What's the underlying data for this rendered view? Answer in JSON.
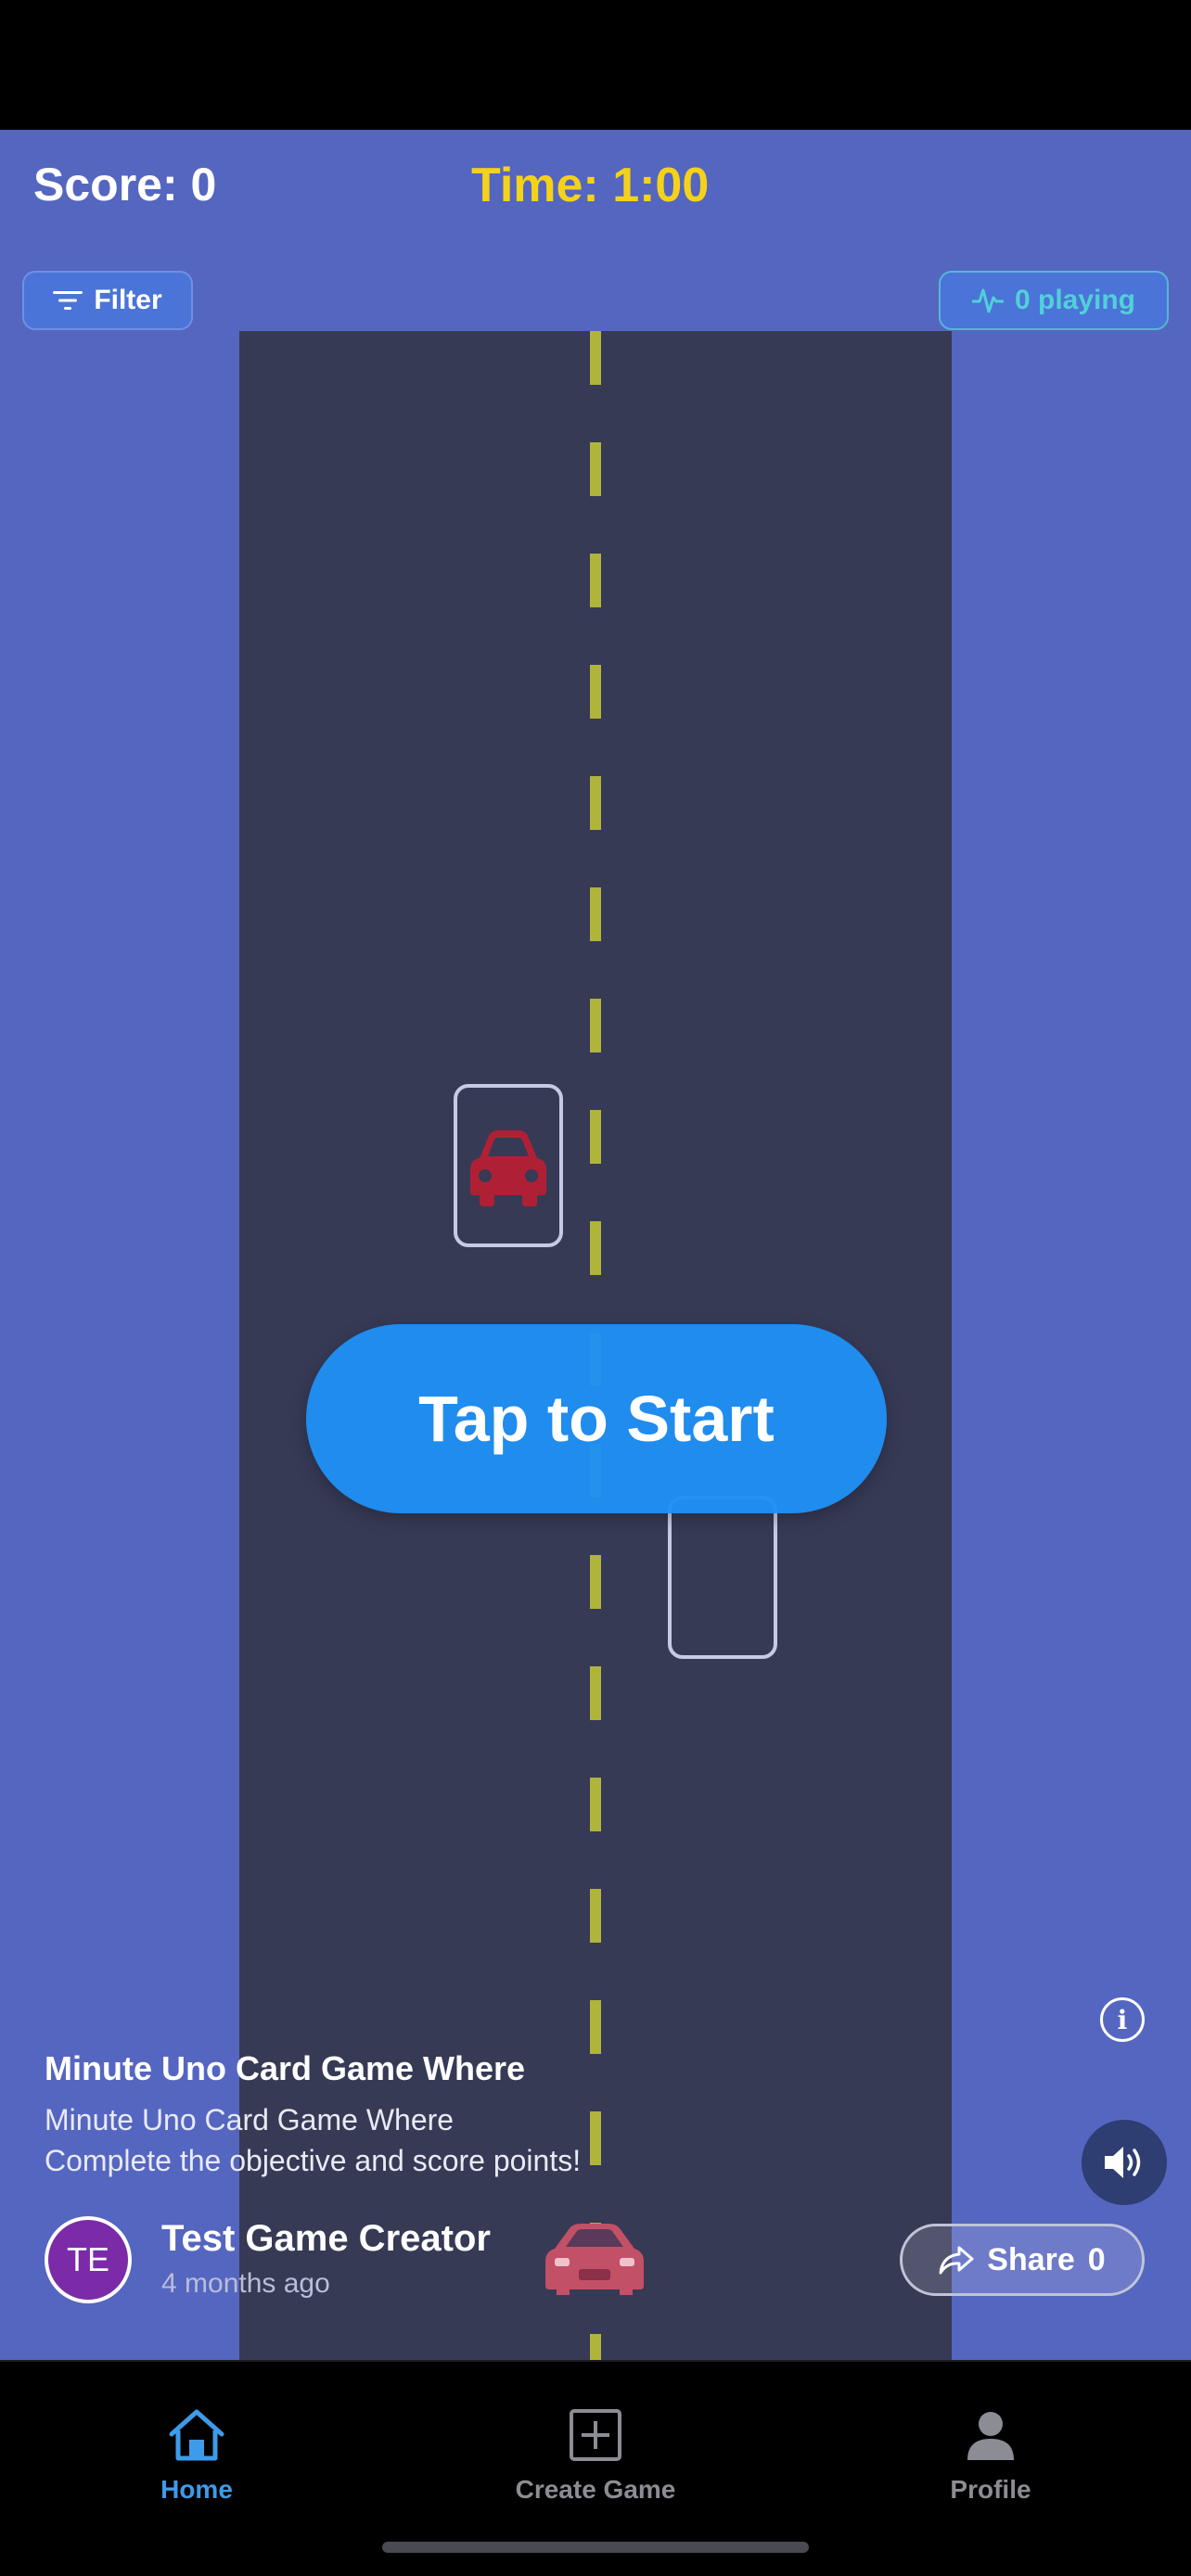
{
  "hud": {
    "score": "Score: 0",
    "time": "Time: 1:00"
  },
  "filter": {
    "label": "Filter"
  },
  "players": {
    "label": "0 playing"
  },
  "start": {
    "label": "Tap to Start"
  },
  "game": {
    "title": "Minute Uno Card Game Where",
    "description_line1": "Minute Uno Card Game Where",
    "description_line2": "Complete the objective and score points!"
  },
  "creator": {
    "initials": "TE",
    "name": "Test Game Creator",
    "time": "4 months ago"
  },
  "share": {
    "label": "Share",
    "count": "0"
  },
  "tabs": [
    {
      "label": "Home",
      "icon": "home-icon",
      "active": true
    },
    {
      "label": "Create Game",
      "icon": "plus-square-icon",
      "active": false
    },
    {
      "label": "Profile",
      "icon": "person-icon",
      "active": false
    }
  ],
  "colors": {
    "background": "#5566c0",
    "road": "#363a55",
    "lane": "#b0b43a",
    "accent": "#1e90f5",
    "time": "#f5d21a",
    "car": "#c0283c"
  }
}
